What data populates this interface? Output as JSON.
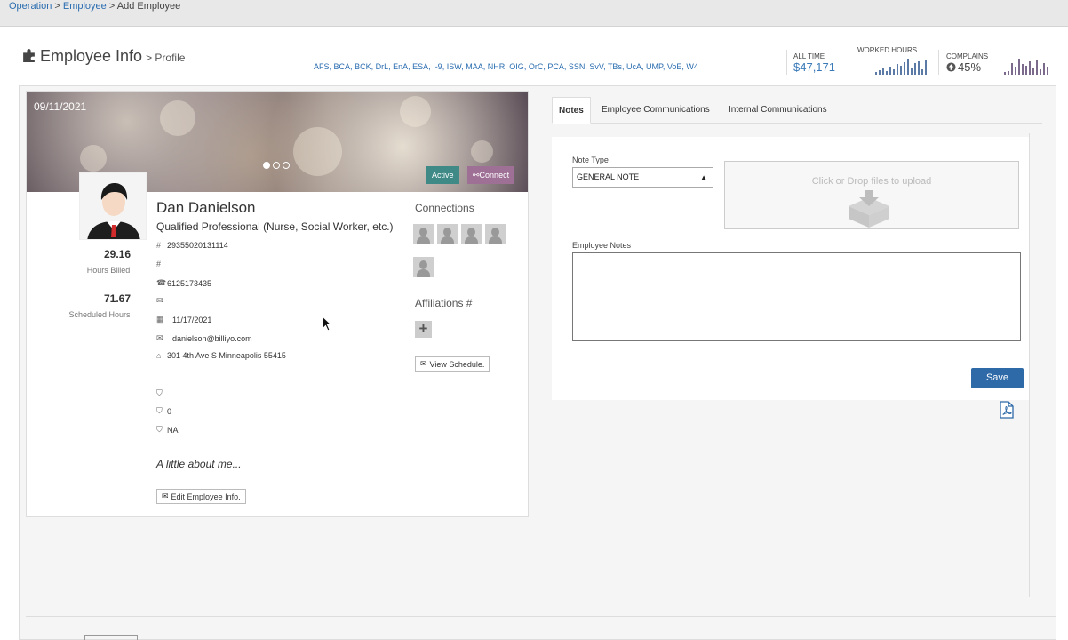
{
  "breadcrumb": {
    "items": [
      "Operation",
      "Employee"
    ],
    "current": "Add Employee",
    "sep": ">"
  },
  "header": {
    "title": "Employee Info",
    "subtitle": "> Profile",
    "doc_links": [
      "AFS",
      "BCA",
      "BCK",
      "DrL",
      "EnA",
      "ESA",
      "I-9",
      "ISW",
      "MAA",
      "NHR",
      "OIG",
      "OrC",
      "PCA",
      "SSN",
      "SvV",
      "TBs",
      "UcA",
      "UMP",
      "VoE",
      "W4"
    ]
  },
  "stats": {
    "all_time_label": "ALL TIME",
    "all_time_value": "$47,171",
    "worked_hours_label": "WORKED HOURS",
    "worked_hours_series": [
      2,
      4,
      6,
      3,
      7,
      5,
      9,
      8,
      11,
      14,
      6,
      10,
      12,
      5,
      13
    ],
    "complains_label": "COMPLAINS",
    "complains_value": "45%",
    "complains_series": [
      2,
      3,
      9,
      6,
      12,
      8,
      7,
      10,
      5,
      11,
      4,
      9,
      6
    ]
  },
  "profile": {
    "banner_date": "09/11/2021",
    "status": "Active",
    "connect_label": "Connect",
    "name": "Dan Danielson",
    "role": "Qualified Professional (Nurse, Social Worker, etc.)",
    "id_number": "29355020131114",
    "id_number_2": "",
    "phone": "6125173435",
    "email_secondary": "",
    "date": "11/17/2021",
    "email": "danielson@billiyo.com",
    "address": "301 4th Ave S Minneapolis 55415",
    "shield_1": "",
    "shield_2": "0",
    "shield_3": "NA",
    "hours_billed": "29.16",
    "hours_billed_label": "Hours Billed",
    "scheduled_hours": "71.67",
    "scheduled_hours_label": "Scheduled Hours",
    "about": "A little about me...",
    "edit_label": "Edit Employee Info."
  },
  "connections": {
    "title": "Connections",
    "count": 5
  },
  "affiliations": {
    "title": "Affiliations #",
    "view_schedule_label": "View Schedule."
  },
  "tabs": [
    {
      "label": "Notes",
      "active": true
    },
    {
      "label": "Employee Communications",
      "active": false
    },
    {
      "label": "Internal Communications",
      "active": false
    }
  ],
  "notes_form": {
    "note_type_label": "Note Type",
    "note_type_value": "GENERAL NOTE",
    "dropzone_text": "Click or Drop files to upload",
    "employee_notes_label": "Employee Notes",
    "employee_notes_value": "",
    "save_label": "Save"
  },
  "colors": {
    "accent": "#2e6aa8",
    "active_badge": "#3f8a86",
    "connect_badge": "#9e7095",
    "link": "#2a6db0"
  },
  "icons": [
    "puzzle-icon",
    "hash-icon",
    "phone-icon",
    "envelope-icon",
    "calendar-icon",
    "home-icon",
    "shield-icon",
    "link-icon",
    "plus-icon",
    "pdf-icon",
    "upload-box-icon",
    "arrow-up-circle-icon",
    "cursor-icon"
  ]
}
